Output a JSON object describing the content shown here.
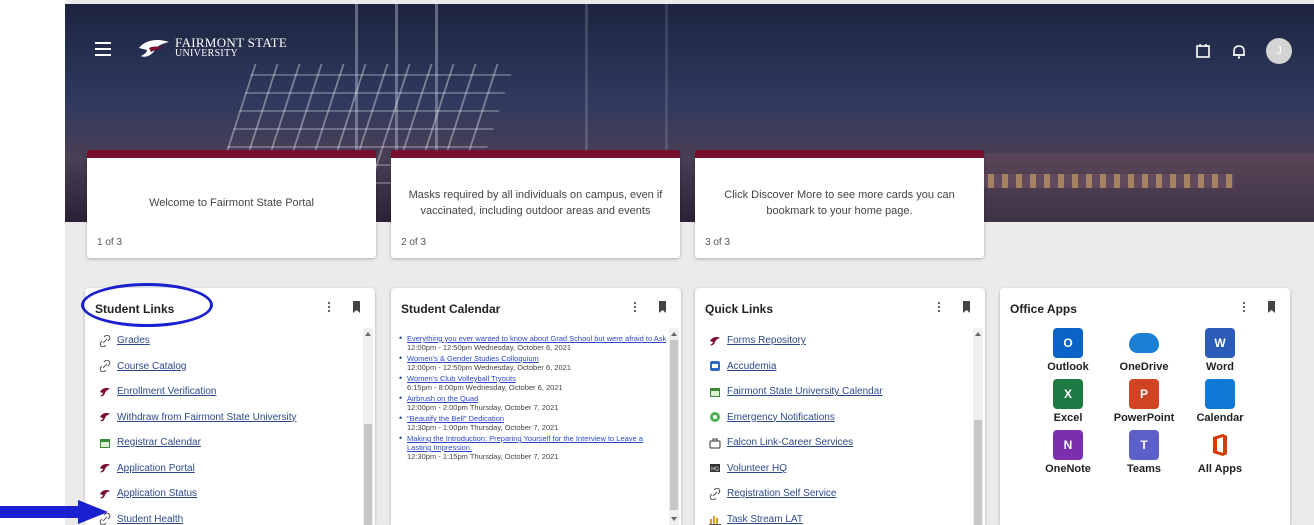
{
  "header": {
    "logo_line1": "FAIRMONT STATE",
    "logo_line2": "UNIVERSITY"
  },
  "announcements": [
    {
      "text": "Welcome to Fairmont State Portal",
      "page": "1 of 3"
    },
    {
      "text": "Masks required by all individuals on campus, even if vaccinated, including outdoor areas and events",
      "page": "2 of 3"
    },
    {
      "text": "Click Discover More to see more cards you can bookmark to your home page.",
      "page": "3 of 3"
    }
  ],
  "student_links": {
    "title": "Student Links",
    "items": [
      {
        "label": "Grades",
        "icon": "link-icon"
      },
      {
        "label": "Course Catalog",
        "icon": "link-icon"
      },
      {
        "label": "Enrollment Verification",
        "icon": "falcon-icon"
      },
      {
        "label": "Withdraw from Fairmont State University",
        "icon": "falcon-icon"
      },
      {
        "label": "Registrar Calendar",
        "icon": "calendar-icon"
      },
      {
        "label": "Application Portal",
        "icon": "falcon-icon"
      },
      {
        "label": "Application Status",
        "icon": "falcon-icon"
      },
      {
        "label": "Student Health",
        "icon": "link-icon"
      }
    ]
  },
  "student_calendar": {
    "title": "Student Calendar",
    "events": [
      {
        "title": "Everything you ever wanted to know about Grad School but were afraid to Ask",
        "when": "12:00pm - 12:50pm Wednesday, October 6, 2021"
      },
      {
        "title": "Women's & Gender Studies Colloquium",
        "when": "12:00pm - 12:50pm Wednesday, October 6, 2021"
      },
      {
        "title": "Women's Club Volleyball Tryouts",
        "when": "6:15pm - 8:00pm Wednesday, October 6, 2021"
      },
      {
        "title": "Airbrush on the Quad",
        "when": "12:00pm - 2:00pm Thursday, October 7, 2021"
      },
      {
        "title": "\"Beautify the Bell\" Dedication",
        "when": "12:30pm - 1:00pm Thursday, October 7, 2021"
      },
      {
        "title": "Making the Introduction: Preparing Yourself for the Interview to Leave a Lasting Impression.",
        "when": "12:30pm - 1:15pm Thursday, October 7, 2021"
      }
    ]
  },
  "quick_links": {
    "title": "Quick Links",
    "items": [
      {
        "label": "Forms Repository",
        "icon": "falcon-icon"
      },
      {
        "label": "Accudemia",
        "icon": "accudemia-icon"
      },
      {
        "label": "Fairmont State University Calendar",
        "icon": "calendar-icon"
      },
      {
        "label": "Emergency Notifications",
        "icon": "alert-icon"
      },
      {
        "label": "Falcon Link-Career Services",
        "icon": "briefcase-icon"
      },
      {
        "label": "Volunteer HQ",
        "icon": "volunteer-icon"
      },
      {
        "label": "Registration Self Service",
        "icon": "link-icon"
      },
      {
        "label": "Task Stream LAT",
        "icon": "chart-icon"
      }
    ]
  },
  "office_apps": {
    "title": "Office Apps",
    "apps": [
      {
        "name": "Outlook",
        "letter": "O",
        "color": "#0a64c8"
      },
      {
        "name": "OneDrive",
        "letter": "",
        "color": "#1b7fd6"
      },
      {
        "name": "Word",
        "letter": "W",
        "color": "#2b5cb8"
      },
      {
        "name": "Excel",
        "letter": "X",
        "color": "#1d7a45"
      },
      {
        "name": "PowerPoint",
        "letter": "P",
        "color": "#d04423"
      },
      {
        "name": "Calendar",
        "letter": "",
        "color": "#0f78d4"
      },
      {
        "name": "OneNote",
        "letter": "N",
        "color": "#7b2fae"
      },
      {
        "name": "Teams",
        "letter": "T",
        "color": "#5b5fc7"
      },
      {
        "name": "All Apps",
        "letter": "",
        "color": "#d83b01"
      }
    ]
  },
  "colors": {
    "brand_maroon": "#7a0e2e",
    "annotation_blue": "#1a1fd0",
    "link_blue": "#2c4a8a"
  }
}
